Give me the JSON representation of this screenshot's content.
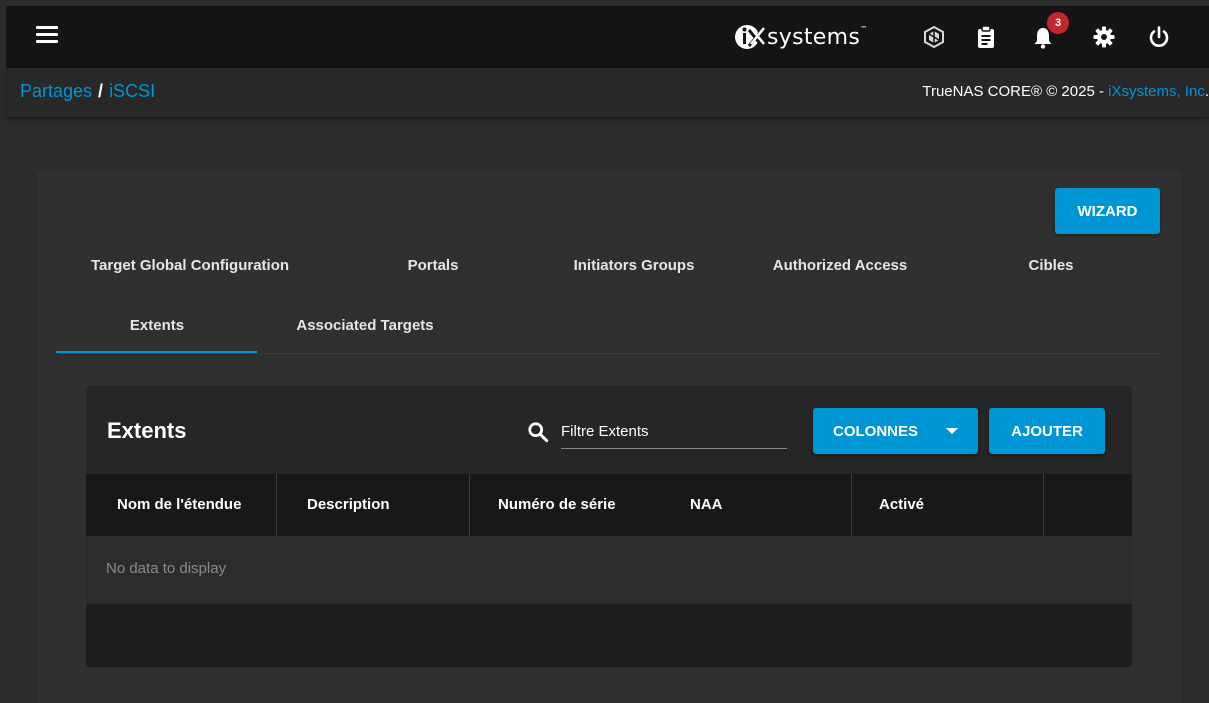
{
  "topbar": {
    "logo_text": "systems",
    "notification_count": "3",
    "icons": [
      "menu-icon",
      "truecommand-icon",
      "clipboard-icon",
      "bell-icon",
      "gear-icon",
      "power-icon"
    ]
  },
  "breadcrumb": {
    "parent": "Partages",
    "separator": "/",
    "current": "iSCSI"
  },
  "copyright": {
    "text": "TrueNAS CORE® © 2025 - ",
    "company": "iXsystems, Inc",
    "suffix": "."
  },
  "wizard_label": "WIZARD",
  "tabs": [
    {
      "label": "Target Global Configuration",
      "active": false
    },
    {
      "label": "Portals",
      "active": false
    },
    {
      "label": "Initiators Groups",
      "active": false
    },
    {
      "label": "Authorized Access",
      "active": false
    },
    {
      "label": "Cibles",
      "active": false
    },
    {
      "label": "Extents",
      "active": true
    },
    {
      "label": "Associated Targets",
      "active": false
    }
  ],
  "table": {
    "title": "Extents",
    "search_placeholder": "Filtre Extents",
    "columns_button": "COLONNES",
    "add_button": "AJOUTER",
    "columns": [
      "Nom de l'étendue",
      "Description",
      "Numéro de série",
      "NAA",
      "Activé"
    ],
    "empty_message": "No data to display"
  },
  "colors": {
    "accent": "#0095d5",
    "badge": "#c1272d",
    "background": "#2b2b2b",
    "topbar": "#141414"
  }
}
